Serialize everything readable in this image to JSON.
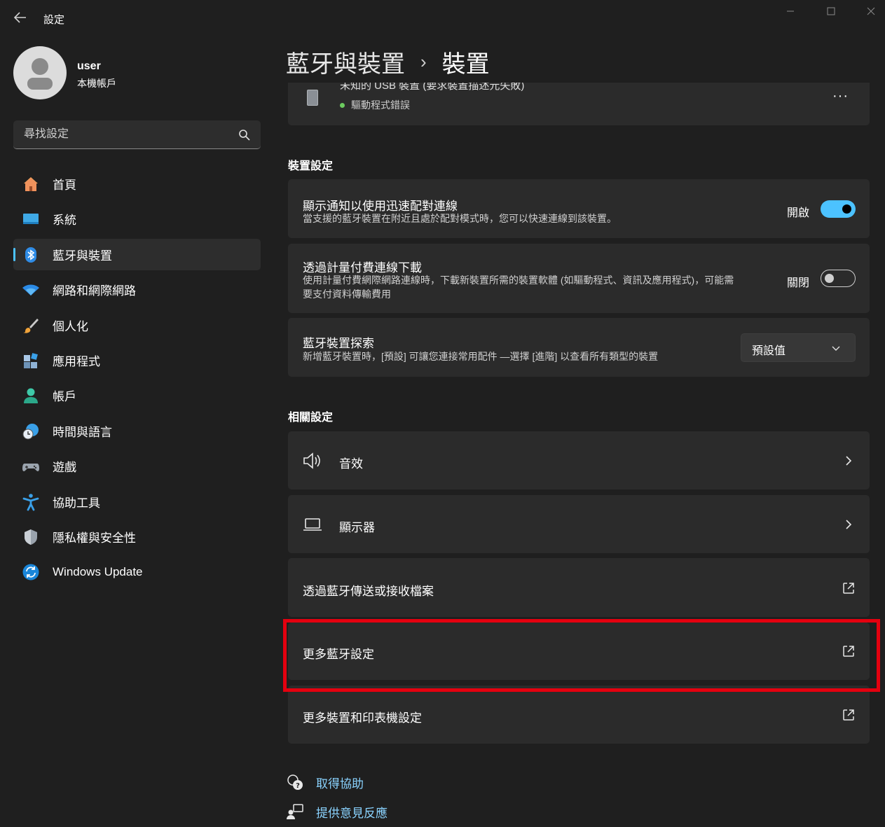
{
  "window": {
    "app_title": "設定"
  },
  "user": {
    "name": "user",
    "account_type": "本機帳戶"
  },
  "search": {
    "placeholder": "尋找設定"
  },
  "sidebar": {
    "items": [
      {
        "label": "首頁",
        "icon": "home-icon"
      },
      {
        "label": "系統",
        "icon": "system-icon"
      },
      {
        "label": "藍牙與裝置",
        "icon": "bluetooth-icon",
        "active": true
      },
      {
        "label": "網路和網際網路",
        "icon": "wifi-icon"
      },
      {
        "label": "個人化",
        "icon": "brush-icon"
      },
      {
        "label": "應用程式",
        "icon": "apps-icon"
      },
      {
        "label": "帳戶",
        "icon": "account-icon"
      },
      {
        "label": "時間與語言",
        "icon": "time-language-icon"
      },
      {
        "label": "遊戲",
        "icon": "gamepad-icon"
      },
      {
        "label": "協助工具",
        "icon": "accessibility-icon"
      },
      {
        "label": "隱私權與安全性",
        "icon": "shield-icon"
      },
      {
        "label": "Windows Update",
        "icon": "windows-update-icon"
      }
    ]
  },
  "breadcrumb": {
    "parent": "藍牙與裝置",
    "separator": "›",
    "current": "裝置"
  },
  "usb_device": {
    "name": "未知的 USB 裝置 (要求裝置描述元失敗)",
    "status": "驅動程式錯誤",
    "more_label": "···"
  },
  "device_settings": {
    "title": "裝置設定",
    "notify": {
      "title": "顯示通知以使用迅速配對連線",
      "desc": "當支援的藍牙裝置在附近且處於配對模式時，您可以快速連線到該裝置。",
      "state_label": "開啟"
    },
    "metered": {
      "title": "透過計量付費連線下載",
      "desc_line1": "使用計量付費網際網路連線時，下載新裝置所需的裝置軟體 (如驅動程式、資訊及應用程式)，可能需",
      "desc_line2": "要支付資料傳輸費用",
      "state_label": "關閉"
    },
    "discovery": {
      "title": "藍牙裝置探索",
      "desc": "新增藍牙裝置時，[預設] 可讓您連接常用配件 —選擇 [進階] 以查看所有類型的裝置",
      "selected": "預設值"
    }
  },
  "related_settings": {
    "title": "相關設定",
    "sound": "音效",
    "display": "顯示器",
    "send_receive": "透過藍牙傳送或接收檔案",
    "more_bluetooth": "更多藍牙設定",
    "more_devices_printers": "更多裝置和印表機設定"
  },
  "help": {
    "get_help": "取得協助",
    "feedback": "提供意見反應"
  },
  "colors": {
    "accent": "#4cc2ff",
    "highlight": "#e4000f",
    "link": "#8ad3ff"
  }
}
